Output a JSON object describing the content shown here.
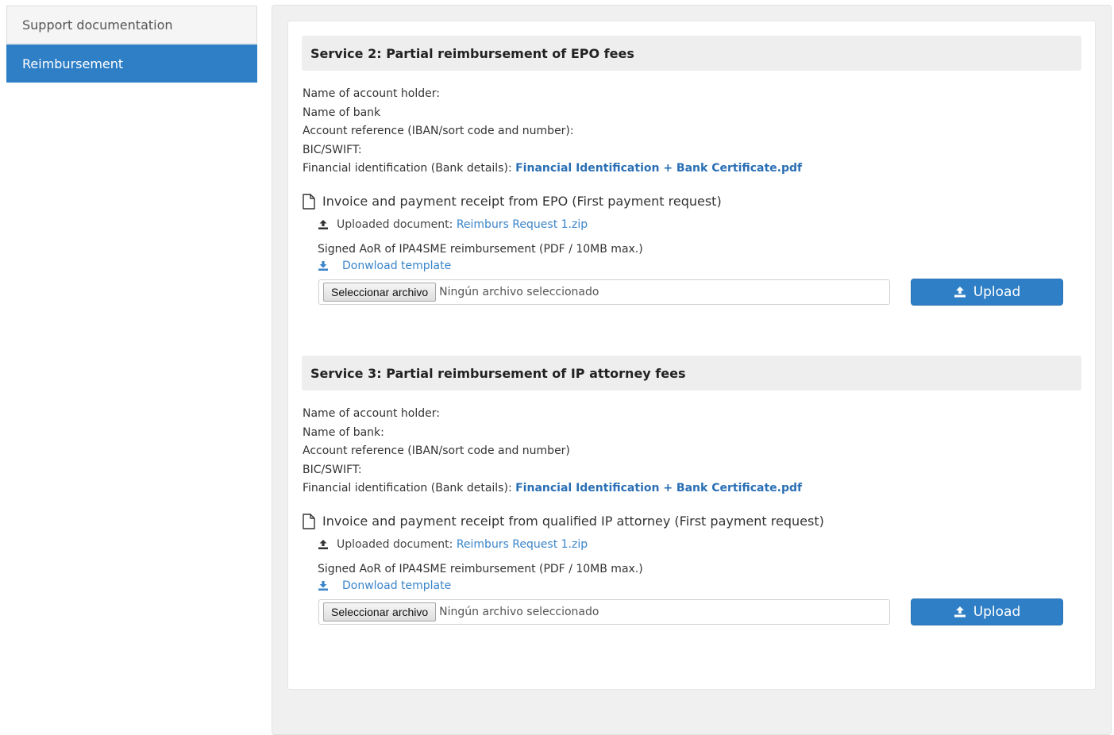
{
  "sidebar": {
    "items": [
      {
        "label": "Support documentation",
        "active": false
      },
      {
        "label": "Reimbursement",
        "active": true
      }
    ]
  },
  "services": [
    {
      "title": "Service 2: Partial reimbursement of EPO fees",
      "account_holder_label": "Name of account holder:",
      "bank_label": "Name of bank",
      "account_ref_label": "Account reference (IBAN/sort code and number):",
      "bic_label": "BIC/SWIFT:",
      "fin_id_label": "Financial identification (Bank details):",
      "fin_id_link": "Financial Identification + Bank Certificate.pdf",
      "doc_title": "Invoice and payment receipt from EPO (First payment request)",
      "uploaded_label": "Uploaded document:",
      "uploaded_link": "Reimburs Request 1.zip",
      "signed_label": "Signed AoR of IPA4SME reimbursement (PDF / 10MB max.)",
      "download_label": "Donwload template",
      "file_button": "Seleccionar archivo",
      "file_text": "Ningún archivo seleccionado",
      "upload_button": "Upload"
    },
    {
      "title": "Service 3: Partial reimbursement of IP attorney fees",
      "account_holder_label": "Name of account holder:",
      "bank_label": "Name of bank:",
      "account_ref_label": "Account reference (IBAN/sort code and number)",
      "bic_label": "BIC/SWIFT:",
      "fin_id_label": "Financial identification (Bank details):",
      "fin_id_link": "Financial Identification + Bank Certificate.pdf",
      "doc_title": "Invoice and payment receipt from qualified IP attorney (First payment request)",
      "uploaded_label": "Uploaded document:",
      "uploaded_link": "Reimburs Request 1.zip",
      "signed_label": "Signed AoR of IPA4SME reimbursement (PDF / 10MB max.)",
      "download_label": "Donwload template",
      "file_button": "Seleccionar archivo",
      "file_text": "Ningún archivo seleccionado",
      "upload_button": "Upload"
    }
  ],
  "icons": {
    "document": "file-outline-icon",
    "uploaded": "upload-icon",
    "download": "download-icon",
    "upload_button": "upload-icon"
  },
  "colors": {
    "accent": "#2f7fc6",
    "link": "#2a6fb5"
  }
}
